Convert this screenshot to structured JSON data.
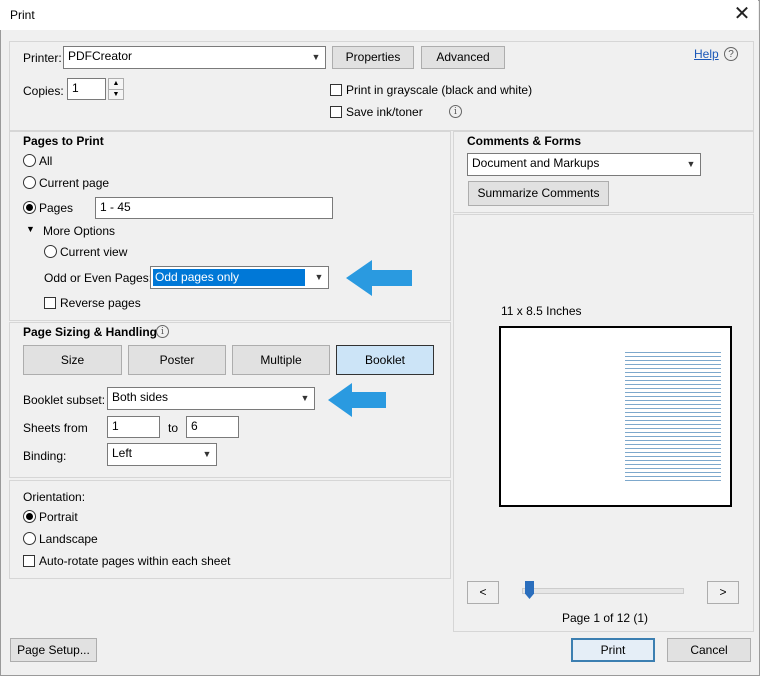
{
  "window": {
    "title": "Print",
    "close": "✕"
  },
  "top": {
    "printer_label": "Printer:",
    "printer_value": "PDFCreator",
    "properties_label": "Properties",
    "advanced_label": "Advanced",
    "help_label": "Help",
    "copies_label": "Copies:",
    "copies_value": "1",
    "grayscale_label": "Print in grayscale (black and white)",
    "save_ink_label": "Save ink/toner"
  },
  "pages_to_print": {
    "title": "Pages to Print",
    "all_label": "All",
    "current_page_label": "Current page",
    "pages_label": "Pages",
    "pages_value": "1 - 45",
    "more_options_label": "More Options",
    "current_view_label": "Current view",
    "odd_even_label": "Odd or Even Pages:",
    "odd_even_value": "Odd pages only",
    "reverse_label": "Reverse pages"
  },
  "sizing": {
    "title": "Page Sizing & Handling",
    "size_label": "Size",
    "poster_label": "Poster",
    "multiple_label": "Multiple",
    "booklet_label": "Booklet",
    "subset_label": "Booklet subset:",
    "subset_value": "Both sides",
    "sheets_from_label": "Sheets from",
    "sheets_from_value": "1",
    "to_label": "to",
    "sheets_to_value": "6",
    "binding_label": "Binding:",
    "binding_value": "Left"
  },
  "orientation": {
    "title": "Orientation:",
    "portrait_label": "Portrait",
    "landscape_label": "Landscape",
    "autorotate_label": "Auto-rotate pages within each sheet"
  },
  "comments": {
    "title": "Comments & Forms",
    "value": "Document and Markups",
    "summarize_label": "Summarize Comments"
  },
  "preview": {
    "size_text": "11 x 8.5 Inches",
    "prev": "<",
    "next": ">",
    "page_status": "Page 1 of 12 (1)"
  },
  "footer": {
    "page_setup_label": "Page Setup...",
    "print_label": "Print",
    "cancel_label": "Cancel"
  },
  "colors": {
    "accent": "#2a9ae0",
    "selection": "#0078d7",
    "slider": "#2a6ebd"
  }
}
